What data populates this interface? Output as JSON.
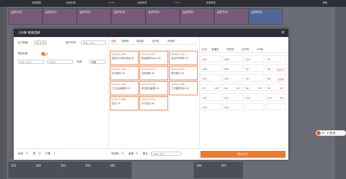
{
  "background": {
    "topbar": [
      "全部楼层",
      "全部区域",
      "¥346",
      "全部状态",
      "¥88",
      "全部类型",
      "搜索"
    ],
    "rooms_top": [
      "足疗1(1)",
      "足疗2(1)",
      "足疗3(1)",
      "足疗4(1)",
      "足疗5(1)",
      "足疗6(1)",
      "足疗7(1)",
      "足疗8(1)"
    ],
    "rooms_bottom": [
      "101",
      "102",
      "103",
      "104",
      "105",
      "106",
      "107"
    ],
    "float_pill": "中 · 小 盟 豪",
    "colors": {
      "accent": "#f07a2c",
      "header": "#2c2e35"
    }
  },
  "modal": {
    "title": "2分钟 快速选择",
    "close_icon": "close-icon",
    "form": {
      "staff_count_label": "技工数量:",
      "staff_count_value": "1",
      "minus": "−",
      "plus": "+",
      "phone_label": "客户手机:",
      "phone_placeholder": "请输入手机",
      "prefer_label": "提前安排",
      "search_placeholder": "请输入技师",
      "search2_placeholder": "请选择",
      "gender_label": "性别",
      "gender_value": "不限"
    },
    "package_tabs": [
      "套餐",
      "按摩类",
      "精油类",
      "足疗类",
      "其他类"
    ],
    "packages": [
      {
        "line1": "[004] ¥ 300",
        "line2": "肩颈五行养生精油 60"
      },
      {
        "line1": "[005] ¥ 300",
        "line2": "精油按摩(Spa) 60"
      },
      {
        "line1": "[006] ¥ 200",
        "line2": "足浴SPA按摩 75"
      },
      {
        "line1": "[001] ¥ 160",
        "line2": "中式推拿 60"
      },
      {
        "line1": "[002] ¥ 130",
        "line2": "足底按摩 60"
      },
      {
        "line1": "[003] ¥ 300",
        "line2": "泰式推拿 90"
      },
      {
        "line1": "[101] ¥ 380",
        "line2": "三位合身套餐 90"
      },
      {
        "line1": "[102] ¥ 430",
        "line2": "养生精油套餐 90"
      },
      {
        "line1": "[103] ¥ 380",
        "line2": "三位套餐中秋 90"
      },
      {
        "line1": "[201] ¥ 380",
        "line2": "足浴 70"
      },
      {
        "line1": "[202] ¥ 120",
        "line2": "中式足浴 60"
      }
    ],
    "room_tabs": [
      "全部",
      "普通房",
      "贵宾房",
      "足疗房",
      "VIP房"
    ],
    "rooms": [
      {
        "no": "005",
        "price": ""
      },
      {
        "no": "008",
        "price": ""
      },
      {
        "no": "011",
        "price": ""
      },
      {
        "no": "01",
        "price": ""
      },
      {
        "no": "006",
        "price": ""
      },
      {
        "no": "009",
        "price": ""
      },
      {
        "no": "02",
        "price": ""
      },
      {
        "no": "03",
        "price": "包间10"
      },
      {
        "no": "007",
        "price": ""
      },
      {
        "no": "010",
        "price": ""
      },
      {
        "no": "04",
        "price": ""
      },
      {
        "no": "05",
        "price": "包间8"
      },
      {
        "no": "07",
        "price": "¥87"
      },
      {
        "no": "08",
        "price": "¥87"
      },
      {
        "no": "06",
        "price": "¥87"
      },
      {
        "no": "09",
        "price": "¥87"
      },
      {
        "no": "010",
        "price": ""
      },
      {
        "no": "011",
        "price": ""
      },
      {
        "no": "012",
        "price": ""
      },
      {
        "no": "F19",
        "price": "¥87"
      },
      {
        "no": "019",
        "price": ""
      },
      {
        "no": "020",
        "price": ""
      },
      {
        "no": "",
        "price": ""
      },
      {
        "no": "",
        "price": ""
      }
    ],
    "footer": {
      "staff_label": "技师:",
      "staff_value": "0",
      "male_label": "男:",
      "male_value": "0",
      "not_label": "不限:",
      "not_value": "1",
      "selected_label": "项目数:",
      "selected_value": "0",
      "total_label": "金额:",
      "total_value": "0",
      "remark_label": "备注:",
      "remark_placeholder": "请输入备注",
      "confirm": "确认开工"
    }
  }
}
